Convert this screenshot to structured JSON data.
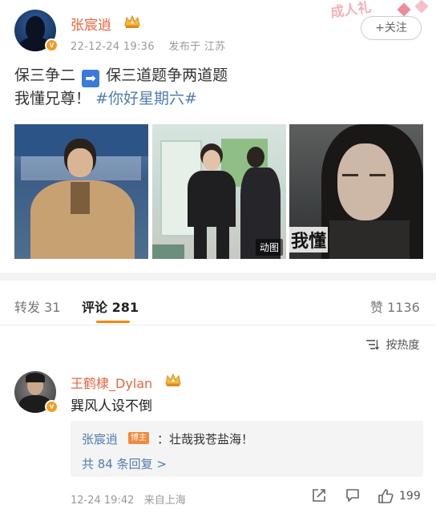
{
  "post": {
    "username": "张宸逍",
    "verified_mark": "v",
    "time": "22-12-24 19:36",
    "location_label": "发布于 江苏",
    "sticker_text": "成人礼",
    "follow_label": "+关注",
    "line1_part1": "保三争二",
    "line1_part2": "保三道题争两道题",
    "line2_text": "我懂兄尊！",
    "hashtag": "#你好星期六#",
    "image3_caption": "我懂",
    "image2_badge": "动图",
    "icons": [
      "crown-icon",
      "arrow-right-icon",
      "verified-icon"
    ]
  },
  "tabs": {
    "repost_label": "转发",
    "repost_count": "31",
    "comment_label": "评论",
    "comment_count": "281",
    "like_label": "赞",
    "like_count": "1136"
  },
  "sort": {
    "label": "按热度"
  },
  "comment": {
    "username": "王鹤棣_Dylan",
    "verified_mark": "v",
    "text": "巽风人设不倒",
    "reply": {
      "username": "张宸逍",
      "badge": "博主",
      "text": "：壮哉我苍盐海！",
      "more_label": "共 84 条回复 >"
    },
    "time": "12-24 19:42",
    "location": "来自上海",
    "likes": "199"
  },
  "colors": {
    "username": "#e8653f",
    "link": "#507daf",
    "accent": "#ff8200",
    "verified": "#f49b21"
  }
}
